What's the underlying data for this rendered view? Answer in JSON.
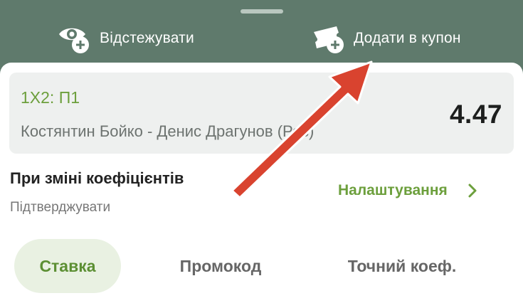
{
  "topbar": {
    "track_label": "Відстежувати",
    "track_icon": "eye-plus-icon",
    "add_coupon_label": "Додати в купон",
    "add_coupon_icon": "ticket-plus-icon"
  },
  "bet_card": {
    "market": "1X2: П1",
    "match": "Костянтин Бойко - Денис Драгунов (Рос)",
    "odds": "4.47"
  },
  "odds_change": {
    "title": "При зміні коефіцієнтів",
    "value": "Підтверджувати",
    "settings_label": "Налаштування",
    "settings_icon": "chevron-right-icon"
  },
  "tabs": [
    {
      "label": "Ставка",
      "active": true
    },
    {
      "label": "Промокод",
      "active": false
    },
    {
      "label": "Точний коеф.",
      "active": false
    }
  ],
  "annotation": {
    "type": "arrow",
    "color": "#d9432f",
    "target": "add-coupon-button"
  },
  "colors": {
    "header_bg": "#5f7a6c",
    "accent_green": "#6c9f3c",
    "card_bg": "#eef0ef",
    "tab_active_bg": "#e9f1e2"
  }
}
